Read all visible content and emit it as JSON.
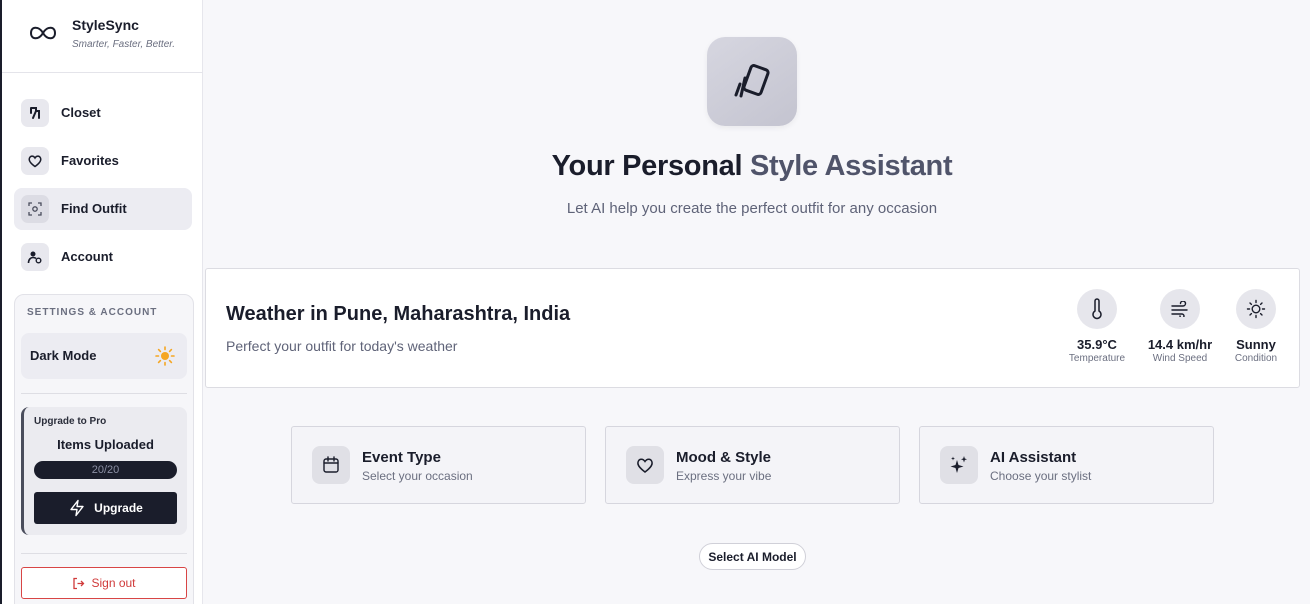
{
  "brand": {
    "name": "StyleSync",
    "tagline": "Smarter, Faster, Better."
  },
  "nav": [
    {
      "label": "Closet",
      "icon": "hanger-icon"
    },
    {
      "label": "Favorites",
      "icon": "heart-icon"
    },
    {
      "label": "Find Outfit",
      "icon": "scan-icon",
      "active": true
    },
    {
      "label": "Account",
      "icon": "user-settings-icon"
    }
  ],
  "settings": {
    "title": "SETTINGS & ACCOUNT",
    "dark_mode_label": "Dark Mode",
    "upgrade": {
      "heading": "Upgrade to Pro",
      "items_label": "Items Uploaded",
      "progress_text": "20/20",
      "progress_fraction": 1.0,
      "button_label": "Upgrade"
    },
    "sign_out_label": "Sign out"
  },
  "hero": {
    "title_main": "Your Personal ",
    "title_muted": "Style Assistant",
    "subtitle": "Let AI help you create the perfect outfit for any occasion"
  },
  "weather": {
    "title": "Weather in Pune, Maharashtra, India",
    "subtitle": "Perfect your outfit for today's weather",
    "stats": [
      {
        "value": "35.9°C",
        "label": "Temperature",
        "icon": "thermometer-icon"
      },
      {
        "value": "14.4 km/hr",
        "label": "Wind Speed",
        "icon": "wind-icon"
      },
      {
        "value": "Sunny",
        "label": "Condition",
        "icon": "sun-icon"
      }
    ]
  },
  "cards": [
    {
      "title": "Event Type",
      "subtitle": "Select your occasion",
      "icon": "calendar-icon"
    },
    {
      "title": "Mood & Style",
      "subtitle": "Express your vibe",
      "icon": "heart-icon"
    },
    {
      "title": "AI Assistant",
      "subtitle": "Choose your stylist",
      "icon": "sparkles-icon"
    }
  ],
  "model_button_label": "Select AI Model",
  "colors": {
    "accent_dark": "#1a1d2b",
    "danger": "#d84545",
    "sun": "#f5a623"
  }
}
